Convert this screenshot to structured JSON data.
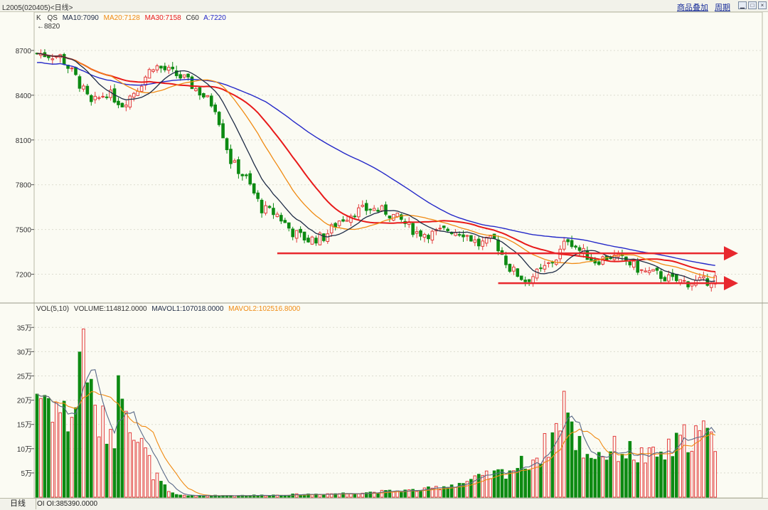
{
  "titlebar": {
    "code": "L2005(020405)<日线>",
    "overlay_link": "商品叠加",
    "period_link": "周期"
  },
  "main_panel": {
    "legend": {
      "k": "K",
      "qs": "QS",
      "ma10": "MA10:7090",
      "ma20": "MA20:7128",
      "ma30": "MA30:7158",
      "c60": "C60",
      "a": "A:7220"
    },
    "high_marker": "←8820",
    "price_ticks": [
      "8700",
      "8400",
      "8100",
      "7800",
      "7500",
      "7200"
    ]
  },
  "volume_panel": {
    "legend": {
      "vol": "VOL(5,10)",
      "volume": "VOLUME:114812.0000",
      "mavol1": "MAVOL1:107018.0000",
      "mavol2": "MAVOL2:102516.8000"
    },
    "ticks": [
      "35万",
      "30万",
      "25万",
      "20万",
      "15万",
      "10万",
      "5万"
    ]
  },
  "bottombar": {
    "tab": "日线",
    "oi": "OI OI:385390.0000"
  },
  "colors": {
    "up": "#e33b3b",
    "down": "#0d8a12",
    "ma10": "#1e2b45",
    "ma20": "#f08a12",
    "ma30": "#e81a1a",
    "c60": "#2428c8",
    "arrow": "#e8282e"
  },
  "chart_data": {
    "type": "candlestick",
    "price_axis": {
      "min": 7050,
      "max": 8900
    },
    "volume_axis_wan": {
      "min": 0,
      "max": 39
    },
    "price_anchors": [
      [
        0,
        8680
      ],
      [
        6,
        8660
      ],
      [
        10,
        8520
      ],
      [
        14,
        8340
      ],
      [
        18,
        8420
      ],
      [
        22,
        8340
      ],
      [
        26,
        8450
      ],
      [
        30,
        8600
      ],
      [
        34,
        8560
      ],
      [
        38,
        8510
      ],
      [
        42,
        8420
      ],
      [
        46,
        8320
      ],
      [
        50,
        7960
      ],
      [
        54,
        7840
      ],
      [
        58,
        7640
      ],
      [
        62,
        7600
      ],
      [
        66,
        7480
      ],
      [
        70,
        7430
      ],
      [
        74,
        7450
      ],
      [
        78,
        7560
      ],
      [
        82,
        7620
      ],
      [
        86,
        7640
      ],
      [
        90,
        7620
      ],
      [
        94,
        7560
      ],
      [
        98,
        7480
      ],
      [
        102,
        7470
      ],
      [
        106,
        7500
      ],
      [
        110,
        7480
      ],
      [
        114,
        7400
      ],
      [
        118,
        7430
      ],
      [
        122,
        7240
      ],
      [
        126,
        7160
      ],
      [
        130,
        7220
      ],
      [
        134,
        7310
      ],
      [
        137,
        7440
      ],
      [
        140,
        7360
      ],
      [
        144,
        7290
      ],
      [
        148,
        7320
      ],
      [
        152,
        7290
      ],
      [
        156,
        7220
      ],
      [
        160,
        7200
      ],
      [
        164,
        7160
      ],
      [
        168,
        7145
      ],
      [
        172,
        7150
      ],
      [
        175,
        7175
      ]
    ],
    "volume_anchors": [
      [
        0,
        22
      ],
      [
        4,
        20
      ],
      [
        8,
        16
      ],
      [
        10,
        19
      ],
      [
        12,
        36
      ],
      [
        14,
        20
      ],
      [
        16,
        15
      ],
      [
        20,
        14
      ],
      [
        22,
        27
      ],
      [
        24,
        18
      ],
      [
        26,
        12
      ],
      [
        28,
        9
      ],
      [
        30,
        5
      ],
      [
        32,
        3
      ],
      [
        34,
        1
      ],
      [
        36,
        0.5
      ],
      [
        40,
        0.3
      ],
      [
        60,
        0.4
      ],
      [
        80,
        0.8
      ],
      [
        100,
        1.5
      ],
      [
        110,
        3
      ],
      [
        120,
        5
      ],
      [
        126,
        7
      ],
      [
        130,
        9
      ],
      [
        134,
        14
      ],
      [
        136,
        21
      ],
      [
        138,
        13
      ],
      [
        142,
        9
      ],
      [
        146,
        9
      ],
      [
        150,
        10
      ],
      [
        154,
        9
      ],
      [
        158,
        8
      ],
      [
        162,
        9
      ],
      [
        166,
        11
      ],
      [
        168,
        13
      ],
      [
        172,
        13
      ],
      [
        175,
        11
      ]
    ],
    "arrows": [
      {
        "from": [
          62,
          7340
        ],
        "to": [
          180,
          7340
        ]
      },
      {
        "from": [
          119,
          7140
        ],
        "to": [
          180,
          7140
        ]
      }
    ]
  }
}
